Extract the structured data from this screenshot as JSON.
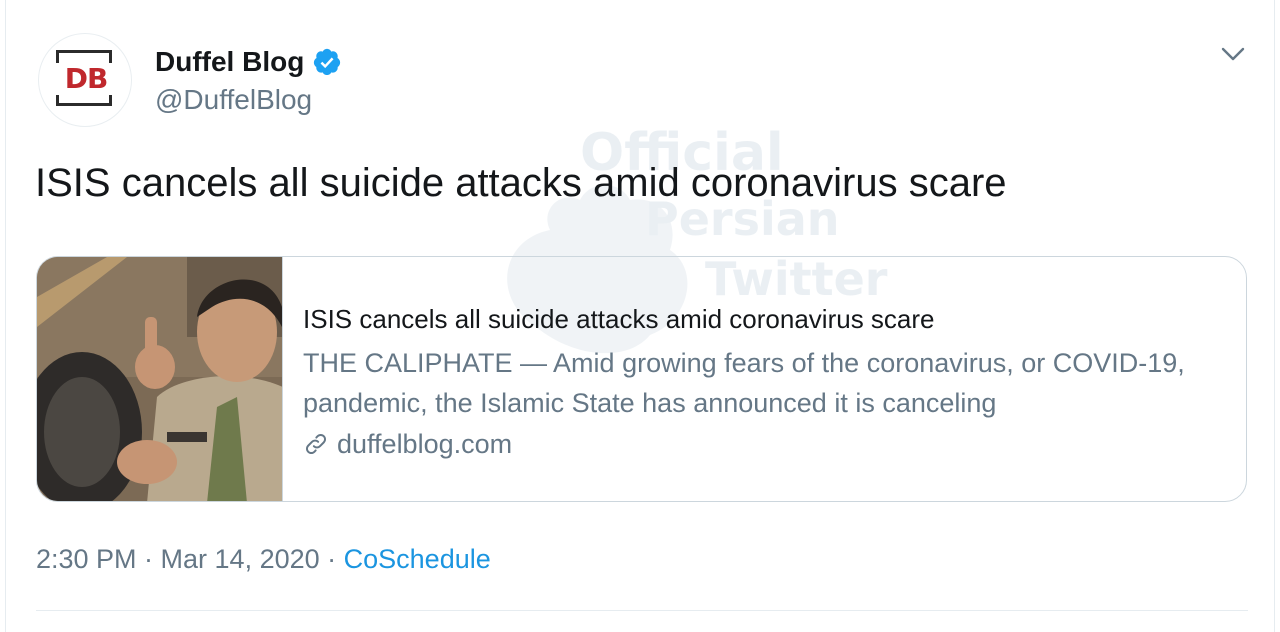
{
  "tweet": {
    "author_name": "Duffel Blog",
    "author_handle": "@DuffelBlog",
    "avatar_logo_text": "DB",
    "text": "ISIS cancels all suicide attacks amid coronavirus scare",
    "timestamp": "2:30 PM · Mar 14, 2020 · ",
    "source": "CoSchedule"
  },
  "card": {
    "title": "ISIS cancels all suicide attacks amid coronavirus scare",
    "description": "THE CALIPHATE — Amid growing fears of the coronavirus, or COVID-19, pandemic, the Islamic State has announced it is canceling",
    "domain": "duffelblog.com"
  },
  "watermark": {
    "line1": "Official",
    "line2": "Persian",
    "line3": "Twitter"
  },
  "icons": {
    "verified": "verified-badge-icon",
    "caret": "chevron-down-icon",
    "link": "link-icon"
  },
  "colors": {
    "verified_blue": "#1da1f2",
    "source_link": "#1b95e0",
    "secondary_text": "#657786",
    "logo_red": "#c0282d"
  }
}
